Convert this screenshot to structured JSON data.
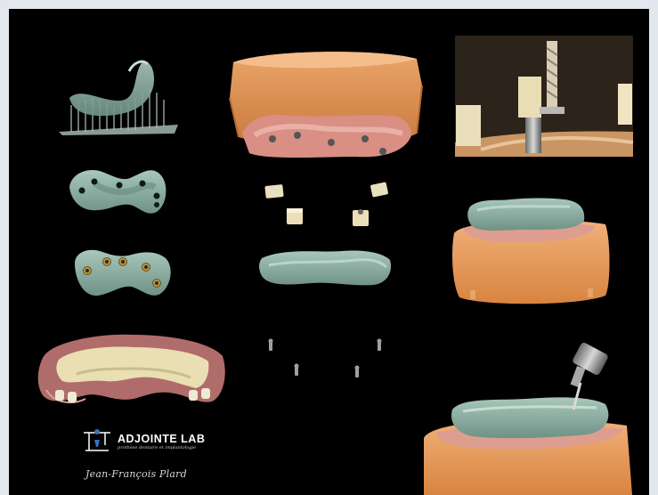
{
  "brand": {
    "name": "ADJOINTE LAB",
    "tagline": "prothèse dentaire et implantologie",
    "logo_icon": "lab-logo-icon"
  },
  "signature": "Jean-François Plard",
  "colors": {
    "background": "#000000",
    "frame": "#e3e8ee",
    "resin_green": "#86a89a",
    "plaster_orange": "#e69a55",
    "gum_pink": "#c98a86",
    "denture_yellow": "#e9dfb2"
  }
}
